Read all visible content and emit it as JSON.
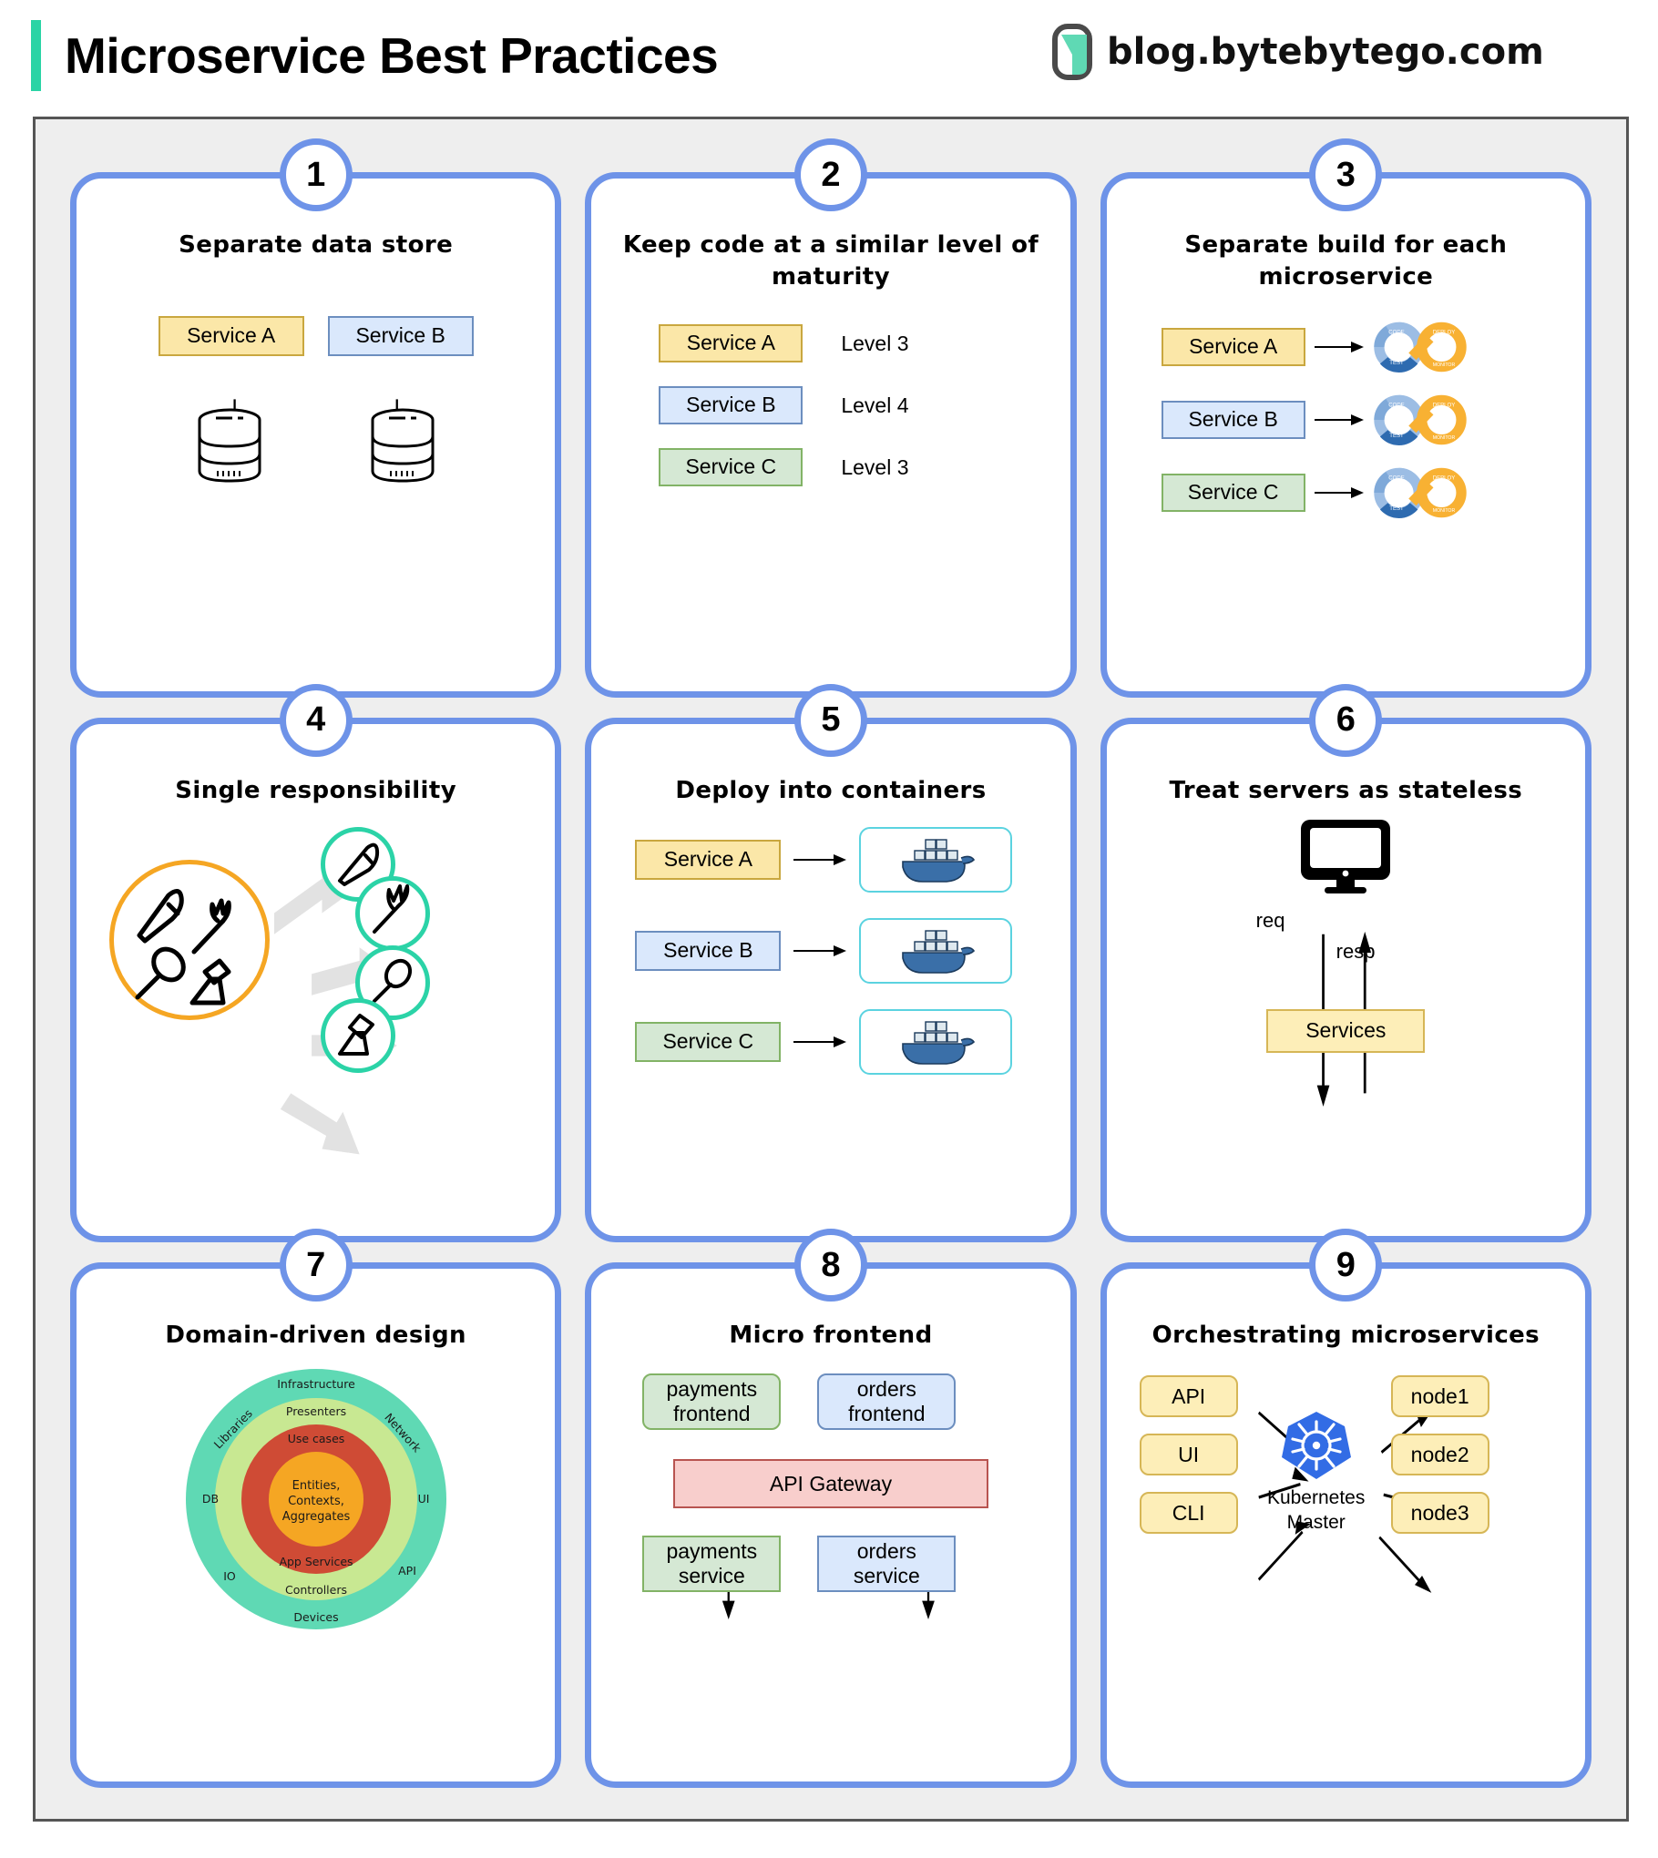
{
  "header": {
    "title": "Microservice Best Practices",
    "brand": "blog.bytebytego.com",
    "accent_color": "#2ad4a5"
  },
  "theme": {
    "card_border": "#6e93e8",
    "board_bg": "#eeeeee",
    "board_border": "#555555",
    "yellow_fill": "#fbe7a8",
    "yellow_border": "#c9a73f",
    "blue_fill": "#dae8fc",
    "blue_border": "#6c8ebf",
    "green_fill": "#d5e8d4",
    "green_border": "#82b366",
    "pink_fill": "#f8cecc",
    "pink_border": "#b85450",
    "teal": "#2bd3a7",
    "orange": "#f5a623",
    "docker_blue": "#2f6eb5",
    "k8s_blue": "#326ce5"
  },
  "cards": [
    {
      "number": "1",
      "title": "Separate data store",
      "services": [
        {
          "label": "Service A",
          "color": "yellow"
        },
        {
          "label": "Service B",
          "color": "blue"
        }
      ],
      "icons": [
        "database-cylinder",
        "database-cylinder"
      ]
    },
    {
      "number": "2",
      "title": "Keep code at a similar level of maturity",
      "rows": [
        {
          "service": "Service A",
          "color": "yellow",
          "level": "Level 3"
        },
        {
          "service": "Service B",
          "color": "blue",
          "level": "Level 4"
        },
        {
          "service": "Service C",
          "color": "green",
          "level": "Level 3"
        }
      ]
    },
    {
      "number": "3",
      "title": "Separate build for each microservice",
      "rows": [
        {
          "service": "Service A",
          "color": "yellow",
          "icon": "cicd-infinity-icon"
        },
        {
          "service": "Service B",
          "color": "blue",
          "icon": "cicd-infinity-icon"
        },
        {
          "service": "Service C",
          "color": "green",
          "icon": "cicd-infinity-icon"
        }
      ]
    },
    {
      "number": "4",
      "title": "Single responsibility",
      "source_icons": [
        "knife-icon",
        "fork-icon",
        "spoon-icon",
        "broom-icon"
      ],
      "target_icons": [
        "knife-icon",
        "fork-icon",
        "spoon-icon",
        "broom-icon"
      ]
    },
    {
      "number": "5",
      "title": "Deploy into containers",
      "rows": [
        {
          "service": "Service A",
          "color": "yellow",
          "icon": "docker-whale-icon"
        },
        {
          "service": "Service B",
          "color": "blue",
          "icon": "docker-whale-icon"
        },
        {
          "service": "Service C",
          "color": "green",
          "icon": "docker-whale-icon"
        }
      ]
    },
    {
      "number": "6",
      "title": "Treat servers as stateless",
      "client_icon": "monitor-icon",
      "request_label": "req",
      "response_label": "resp",
      "services_box": "Services"
    },
    {
      "number": "7",
      "title": "Domain-driven design",
      "onion": {
        "core": "Entities,\nContexts,\nAggregates",
        "core_lines": [
          "Entities,",
          "Contexts,",
          "Aggregates"
        ],
        "ring_red": {
          "top": "Use cases",
          "bottom": "App Services"
        },
        "ring_lightgreen": {
          "top": "Presenters",
          "bottom": "Controllers"
        },
        "ring_teal": {
          "top": "Infrastructure",
          "bottom": "Devices",
          "upper_left": "Libraries",
          "upper_right": "Network",
          "left": "DB",
          "right": "UI",
          "lower_left": "IO",
          "lower_right": "API"
        }
      }
    },
    {
      "number": "8",
      "title": "Micro frontend",
      "frontends": [
        {
          "label": "payments\nfrontend",
          "lines": [
            "payments",
            "frontend"
          ],
          "color": "green"
        },
        {
          "label": "orders\nfrontend",
          "lines": [
            "orders",
            "frontend"
          ],
          "color": "blue"
        }
      ],
      "gateway": "API Gateway",
      "services": [
        {
          "label": "payments\nservice",
          "lines": [
            "payments",
            "service"
          ],
          "color": "green"
        },
        {
          "label": "orders\nservice",
          "lines": [
            "orders",
            "service"
          ],
          "color": "blue"
        }
      ]
    },
    {
      "number": "9",
      "title": "Orchestrating microservices",
      "clients": [
        "API",
        "UI",
        "CLI"
      ],
      "master_lines": [
        "Kubernetes",
        "Master"
      ],
      "master_icon": "kubernetes-icon",
      "nodes": [
        "node1",
        "node2",
        "node3"
      ]
    }
  ]
}
